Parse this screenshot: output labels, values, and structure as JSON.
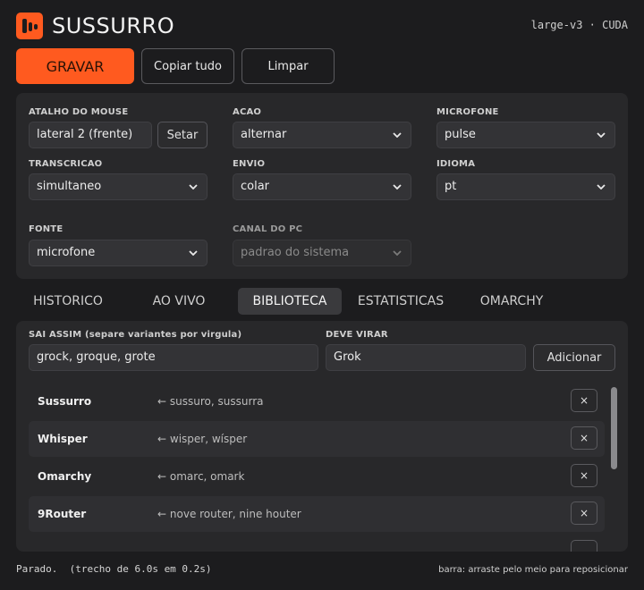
{
  "app": {
    "title": "SUSSURRO",
    "model_info": "large-v3 · CUDA",
    "logo_icon": "waveform-logo-icon"
  },
  "toolbar": {
    "record_label": "GRAVAR",
    "copy_all_label": "Copiar tudo",
    "clear_label": "Limpar"
  },
  "settings": {
    "mouse_shortcut": {
      "label": "ATALHO DO MOUSE",
      "value": "lateral 2 (frente)",
      "set_label": "Setar"
    },
    "action": {
      "label": "ACAO",
      "value": "alternar"
    },
    "microphone": {
      "label": "MICROFONE",
      "value": "pulse"
    },
    "transcription": {
      "label": "TRANSCRICAO",
      "value": "simultaneo"
    },
    "send": {
      "label": "ENVIO",
      "value": "colar"
    },
    "language": {
      "label": "IDIOMA",
      "value": "pt"
    },
    "source": {
      "label": "FONTE",
      "value": "microfone"
    },
    "pc_channel": {
      "label": "CANAL DO PC",
      "value": "padrao do sistema"
    }
  },
  "tabs": [
    {
      "label": "HISTORICO"
    },
    {
      "label": "AO VIVO"
    },
    {
      "label": "BIBLIOTECA",
      "active": true
    },
    {
      "label": "ESTATISTICAS"
    },
    {
      "label": "OMARCHY"
    }
  ],
  "library": {
    "variants_label": "SAI ASSIM (separe variantes por virgula)",
    "variants_value": "grock, groque, grote",
    "target_label": "DEVE VIRAR",
    "target_value": "Grok",
    "add_label": "Adicionar",
    "arrow": "←",
    "delete_glyph": "×",
    "entries": [
      {
        "word": "Sussurro",
        "variants": "sussuro, sussurra"
      },
      {
        "word": "Whisper",
        "variants": "wisper, wísper"
      },
      {
        "word": "Omarchy",
        "variants": "omarc, omark"
      },
      {
        "word": "9Router",
        "variants": "nove router, nine houter"
      }
    ]
  },
  "status": {
    "left": "Parado.  (trecho de 6.0s em 0.2s)",
    "right": "barra: arraste pelo meio para reposicionar"
  },
  "colors": {
    "accent": "#ff5a1f",
    "background": "#1c1c1e",
    "panel": "#28282a"
  }
}
